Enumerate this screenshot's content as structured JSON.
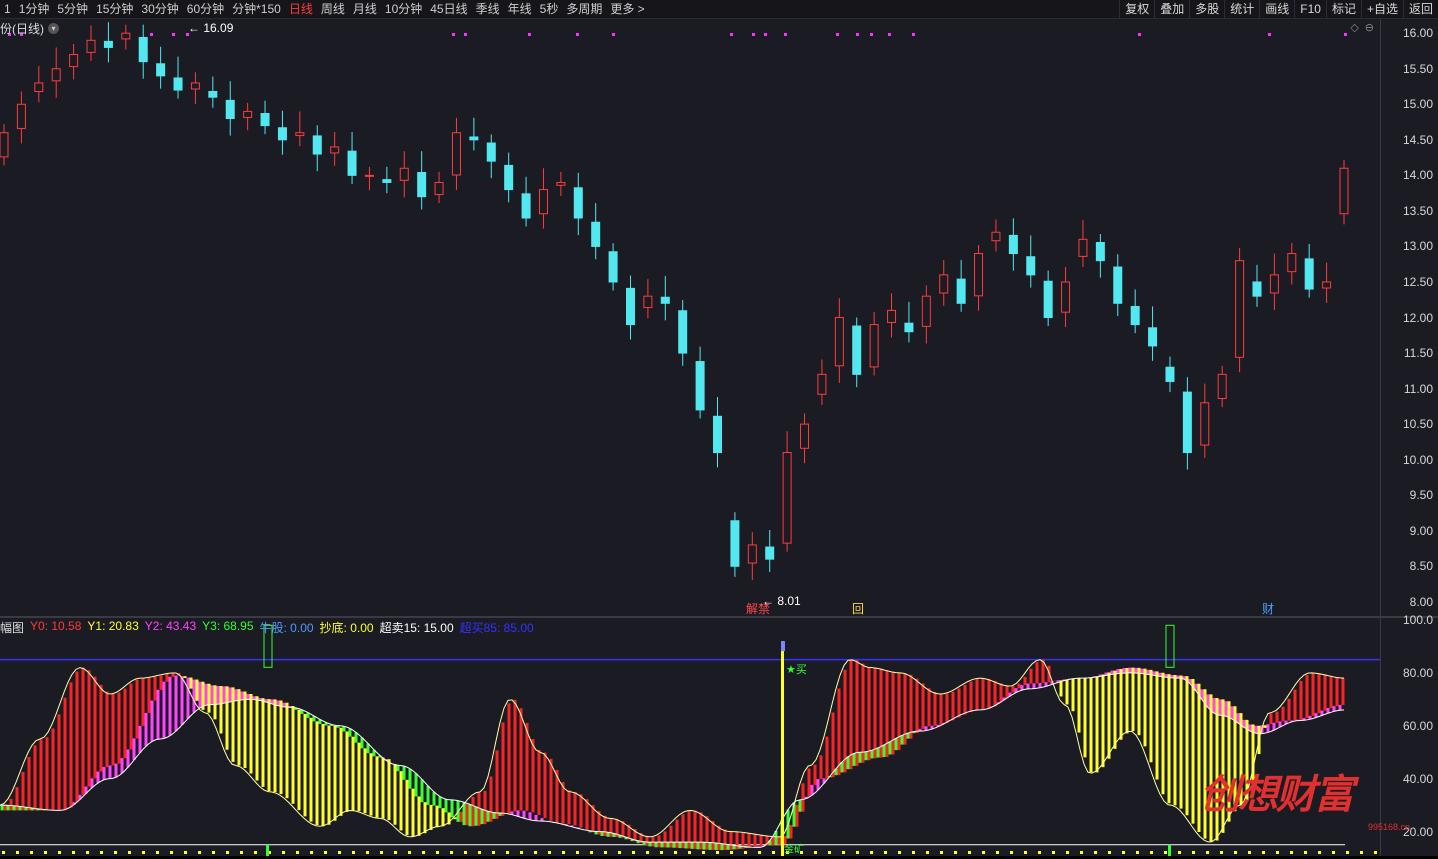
{
  "toolbar": {
    "items": [
      "1",
      "1分钟",
      "5分钟",
      "15分钟",
      "30分钟",
      "60分钟",
      "分钟*150",
      "日线",
      "周线",
      "月线",
      "10分钟",
      "45日线",
      "季线",
      "年线",
      "5秒",
      "多周期",
      "更多 >"
    ],
    "active_index": 7,
    "right_buttons": [
      "复权",
      "叠加",
      "多股",
      "统计",
      "画线",
      "F10",
      "标记",
      "+自选",
      "返回"
    ]
  },
  "main_chart": {
    "title": "份(日线)",
    "y_ticks": [
      "16.00",
      "15.50",
      "15.00",
      "14.50",
      "14.00",
      "13.50",
      "13.00",
      "12.50",
      "12.00",
      "11.50",
      "11.00",
      "10.50",
      "10.00",
      "9.50",
      "9.00",
      "8.50",
      "8.00"
    ],
    "high_label": "16.09",
    "low_label": "8.01",
    "markers": [
      {
        "text": "解禁",
        "color": "#ff4b4b"
      },
      {
        "text": "回",
        "color": "#ffd54a"
      },
      {
        "text": "财",
        "color": "#49a0ff"
      }
    ],
    "up_color": "#ff3b3b",
    "down_color": "#53e8f0",
    "tools": [
      "◇",
      "⊖"
    ]
  },
  "indicator": {
    "name": "幅图",
    "legend": [
      {
        "label": "Y0: 10.58",
        "color": "#ff3b3b"
      },
      {
        "label": "Y1: 20.83",
        "color": "#ffff33"
      },
      {
        "label": "Y2: 43.43",
        "color": "#ff44ff"
      },
      {
        "label": "Y3: 68.95",
        "color": "#33ff33"
      },
      {
        "label": "牛股: 0.00",
        "color": "#4f9bff"
      },
      {
        "label": "抄底: 0.00",
        "color": "#ffff33"
      },
      {
        "label": "超卖15: 15.00",
        "color": "#ffffff"
      },
      {
        "label": "超买85: 85.00",
        "color": "#3333ff"
      }
    ],
    "y_ticks": [
      "100.0",
      "80.00",
      "60.00",
      "40.00",
      "20.00"
    ],
    "buy_label": "★买",
    "bottom_label": "金矿"
  },
  "watermark": {
    "text": "创想财富",
    "url": "995168.cn"
  },
  "chart_data": {
    "type": "candlestick",
    "ylim": [
      7.8,
      16.2
    ],
    "candles_close": [
      14.6,
      15.0,
      15.3,
      15.5,
      15.7,
      15.9,
      15.8,
      16.0,
      15.6,
      15.4,
      15.2,
      15.3,
      15.1,
      14.8,
      14.9,
      14.7,
      14.5,
      14.6,
      14.3,
      14.4,
      14.0,
      14.0,
      13.9,
      14.1,
      13.7,
      13.9,
      14.6,
      14.5,
      14.2,
      13.8,
      13.4,
      13.8,
      13.9,
      13.4,
      13.0,
      12.5,
      11.9,
      12.3,
      12.2,
      11.5,
      10.7,
      10.1,
      8.5,
      8.8,
      8.6,
      10.1,
      10.5,
      11.2,
      12.0,
      11.2,
      11.9,
      12.1,
      11.8,
      12.3,
      12.6,
      12.2,
      12.9,
      13.2,
      12.9,
      12.6,
      12.0,
      12.5,
      13.1,
      12.8,
      12.2,
      11.9,
      11.6,
      11.1,
      10.1,
      10.8,
      11.2,
      12.8,
      12.3,
      12.6,
      12.9,
      12.4,
      12.5,
      14.1
    ],
    "indicator_ylim": [
      10,
      100
    ]
  }
}
